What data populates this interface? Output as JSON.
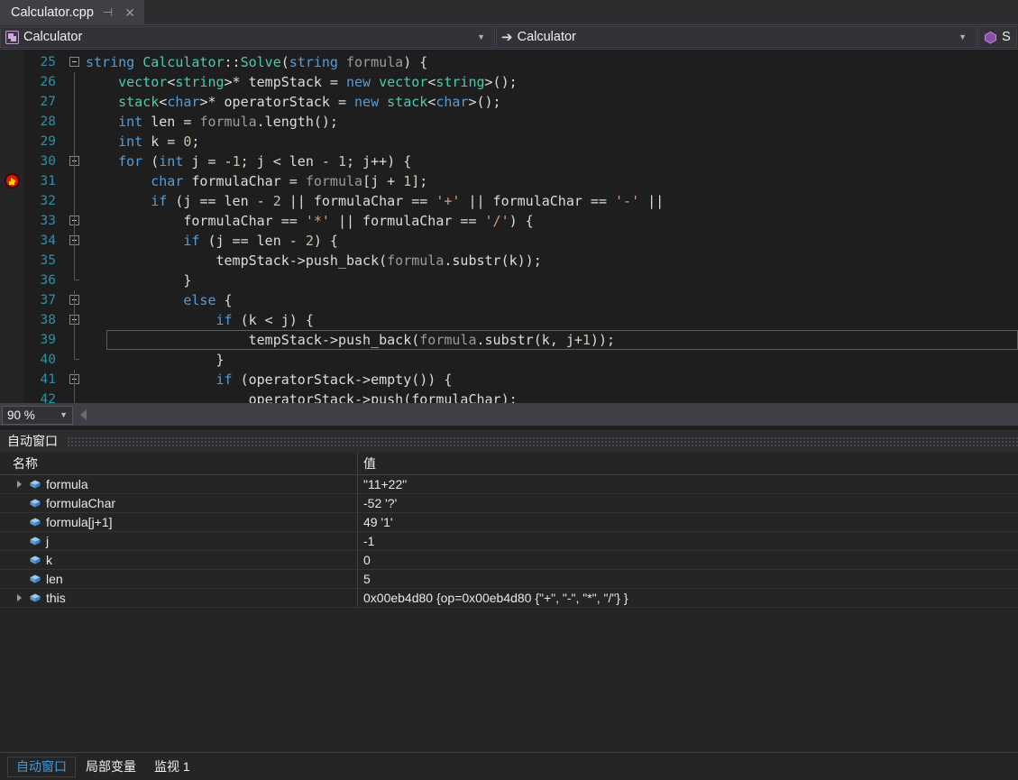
{
  "window": {
    "theme_bg": "#1e1e1e",
    "accent": "#3f9bdc"
  },
  "document_tab": {
    "title": "Calculator.cpp",
    "pin_icon": "pin-icon",
    "close_icon": "close-icon"
  },
  "navbar": {
    "type_combo": {
      "icon": "class-icon",
      "label": "Calculator",
      "caret": "▼"
    },
    "member_combo": {
      "icon": "method-arrow-icon",
      "label": "Calculator",
      "caret": "▼"
    },
    "extra_combo": {
      "icon": "cube-icon",
      "label": "S"
    }
  },
  "editor": {
    "zoom_level": "90 %",
    "zoom_caret": "▼",
    "breakpoint_line": 31,
    "current_line": 39,
    "lines": [
      {
        "n": "25",
        "fold": "minus",
        "indent": 0,
        "tokens": [
          {
            "t": "string",
            "c": "kw"
          },
          {
            "t": " ",
            "c": "pln"
          },
          {
            "t": "Calculator",
            "c": "typ"
          },
          {
            "t": "::",
            "c": "pln"
          },
          {
            "t": "Solve",
            "c": "typ"
          },
          {
            "t": "(",
            "c": "pln"
          },
          {
            "t": "string",
            "c": "kw"
          },
          {
            "t": " ",
            "c": "pln"
          },
          {
            "t": "formula",
            "c": "par"
          },
          {
            "t": ") {",
            "c": "pln"
          }
        ]
      },
      {
        "n": "26",
        "fold": "line",
        "indent": 0,
        "tokens": [
          {
            "t": "    ",
            "c": "pln"
          },
          {
            "t": "vector",
            "c": "typ"
          },
          {
            "t": "<",
            "c": "pln"
          },
          {
            "t": "string",
            "c": "typ"
          },
          {
            "t": ">* tempStack = ",
            "c": "pln"
          },
          {
            "t": "new",
            "c": "kw"
          },
          {
            "t": " ",
            "c": "pln"
          },
          {
            "t": "vector",
            "c": "typ"
          },
          {
            "t": "<",
            "c": "pln"
          },
          {
            "t": "string",
            "c": "typ"
          },
          {
            "t": ">();",
            "c": "pln"
          }
        ]
      },
      {
        "n": "27",
        "fold": "line",
        "indent": 0,
        "tokens": [
          {
            "t": "    ",
            "c": "pln"
          },
          {
            "t": "stack",
            "c": "typ"
          },
          {
            "t": "<",
            "c": "pln"
          },
          {
            "t": "char",
            "c": "kw"
          },
          {
            "t": ">* operatorStack = ",
            "c": "pln"
          },
          {
            "t": "new",
            "c": "kw"
          },
          {
            "t": " ",
            "c": "pln"
          },
          {
            "t": "stack",
            "c": "typ"
          },
          {
            "t": "<",
            "c": "pln"
          },
          {
            "t": "char",
            "c": "kw"
          },
          {
            "t": ">();",
            "c": "pln"
          }
        ]
      },
      {
        "n": "28",
        "fold": "line",
        "indent": 0,
        "tokens": [
          {
            "t": "    ",
            "c": "pln"
          },
          {
            "t": "int",
            "c": "kw"
          },
          {
            "t": " len = ",
            "c": "pln"
          },
          {
            "t": "formula",
            "c": "par"
          },
          {
            "t": ".length();",
            "c": "pln"
          }
        ]
      },
      {
        "n": "29",
        "fold": "line",
        "indent": 0,
        "tokens": [
          {
            "t": "    ",
            "c": "pln"
          },
          {
            "t": "int",
            "c": "kw"
          },
          {
            "t": " k = ",
            "c": "pln"
          },
          {
            "t": "0",
            "c": "num"
          },
          {
            "t": ";",
            "c": "pln"
          }
        ]
      },
      {
        "n": "30",
        "fold": "minus",
        "indent": 0,
        "tokens": [
          {
            "t": "    ",
            "c": "pln"
          },
          {
            "t": "for",
            "c": "kw"
          },
          {
            "t": " (",
            "c": "pln"
          },
          {
            "t": "int",
            "c": "kw"
          },
          {
            "t": " j = -",
            "c": "pln"
          },
          {
            "t": "1",
            "c": "num"
          },
          {
            "t": "; j < len - ",
            "c": "pln"
          },
          {
            "t": "1",
            "c": "num"
          },
          {
            "t": "; j++) {",
            "c": "pln"
          }
        ]
      },
      {
        "n": "31",
        "fold": "line",
        "indent": 0,
        "tokens": [
          {
            "t": "        ",
            "c": "pln"
          },
          {
            "t": "char",
            "c": "kw"
          },
          {
            "t": " formulaChar = ",
            "c": "pln"
          },
          {
            "t": "formula",
            "c": "par"
          },
          {
            "t": "[j + ",
            "c": "pln"
          },
          {
            "t": "1",
            "c": "num"
          },
          {
            "t": "];",
            "c": "pln"
          }
        ]
      },
      {
        "n": "32",
        "fold": "line",
        "indent": 0,
        "tokens": [
          {
            "t": "        ",
            "c": "pln"
          },
          {
            "t": "if",
            "c": "kw"
          },
          {
            "t": " (j == len - ",
            "c": "pln"
          },
          {
            "t": "2",
            "c": "num"
          },
          {
            "t": " || formulaChar == ",
            "c": "pln"
          },
          {
            "t": "'+'",
            "c": "chr"
          },
          {
            "t": " || formulaChar == ",
            "c": "pln"
          },
          {
            "t": "'-'",
            "c": "chr"
          },
          {
            "t": " ||",
            "c": "pln"
          }
        ]
      },
      {
        "n": "33",
        "fold": "minus",
        "indent": 0,
        "tokens": [
          {
            "t": "            formulaChar == ",
            "c": "pln"
          },
          {
            "t": "'*'",
            "c": "chr"
          },
          {
            "t": " || formulaChar == ",
            "c": "pln"
          },
          {
            "t": "'/'",
            "c": "chr"
          },
          {
            "t": ") {",
            "c": "pln"
          }
        ]
      },
      {
        "n": "34",
        "fold": "minus",
        "indent": 0,
        "tokens": [
          {
            "t": "            ",
            "c": "pln"
          },
          {
            "t": "if",
            "c": "kw"
          },
          {
            "t": " (j == len - ",
            "c": "pln"
          },
          {
            "t": "2",
            "c": "num"
          },
          {
            "t": ") {",
            "c": "pln"
          }
        ]
      },
      {
        "n": "35",
        "fold": "line",
        "indent": 0,
        "tokens": [
          {
            "t": "                tempStack->push_back(",
            "c": "pln"
          },
          {
            "t": "formula",
            "c": "par"
          },
          {
            "t": ".substr(k));",
            "c": "pln"
          }
        ]
      },
      {
        "n": "36",
        "fold": "endcap",
        "indent": 0,
        "tokens": [
          {
            "t": "            }",
            "c": "pln"
          }
        ]
      },
      {
        "n": "37",
        "fold": "minus",
        "indent": 0,
        "tokens": [
          {
            "t": "            ",
            "c": "pln"
          },
          {
            "t": "else",
            "c": "kw"
          },
          {
            "t": " {",
            "c": "pln"
          }
        ]
      },
      {
        "n": "38",
        "fold": "minus",
        "indent": 0,
        "tokens": [
          {
            "t": "                ",
            "c": "pln"
          },
          {
            "t": "if",
            "c": "kw"
          },
          {
            "t": " (k < j) {",
            "c": "pln"
          }
        ]
      },
      {
        "n": "39",
        "fold": "line",
        "indent": 0,
        "tokens": [
          {
            "t": "                    tempStack->push_back(",
            "c": "pln"
          },
          {
            "t": "formula",
            "c": "par"
          },
          {
            "t": ".substr(k, j+",
            "c": "pln"
          },
          {
            "t": "1",
            "c": "num"
          },
          {
            "t": "));",
            "c": "pln"
          }
        ]
      },
      {
        "n": "40",
        "fold": "endcap",
        "indent": 0,
        "tokens": [
          {
            "t": "                }",
            "c": "pln"
          }
        ]
      },
      {
        "n": "41",
        "fold": "minus",
        "indent": 0,
        "tokens": [
          {
            "t": "                ",
            "c": "pln"
          },
          {
            "t": "if",
            "c": "kw"
          },
          {
            "t": " (operatorStack->empty()) {",
            "c": "pln"
          }
        ]
      },
      {
        "n": "42",
        "fold": "line",
        "indent": 0,
        "tokens": [
          {
            "t": "                    operatorStack->push(formulaChar);",
            "c": "pln"
          }
        ]
      }
    ]
  },
  "autos": {
    "panel_title": "自动窗口",
    "columns": {
      "name": "名称",
      "value": "值"
    },
    "rows": [
      {
        "expandable": true,
        "name": "formula",
        "value": "\"11+22\""
      },
      {
        "expandable": false,
        "name": "formulaChar",
        "value": "-52 '?'"
      },
      {
        "expandable": false,
        "name": "formula[j+1]",
        "value": "49 '1'"
      },
      {
        "expandable": false,
        "name": "j",
        "value": "-1"
      },
      {
        "expandable": false,
        "name": "k",
        "value": "0"
      },
      {
        "expandable": false,
        "name": "len",
        "value": "5"
      },
      {
        "expandable": true,
        "name": "this",
        "value": "0x00eb4d80 {op=0x00eb4d80 {\"+\", \"-\", \"*\", \"/\"} }"
      }
    ]
  },
  "bottom_tabs": [
    {
      "label": "自动窗口",
      "active": true
    },
    {
      "label": "局部变量",
      "active": false
    },
    {
      "label": "监视 1",
      "active": false
    }
  ]
}
